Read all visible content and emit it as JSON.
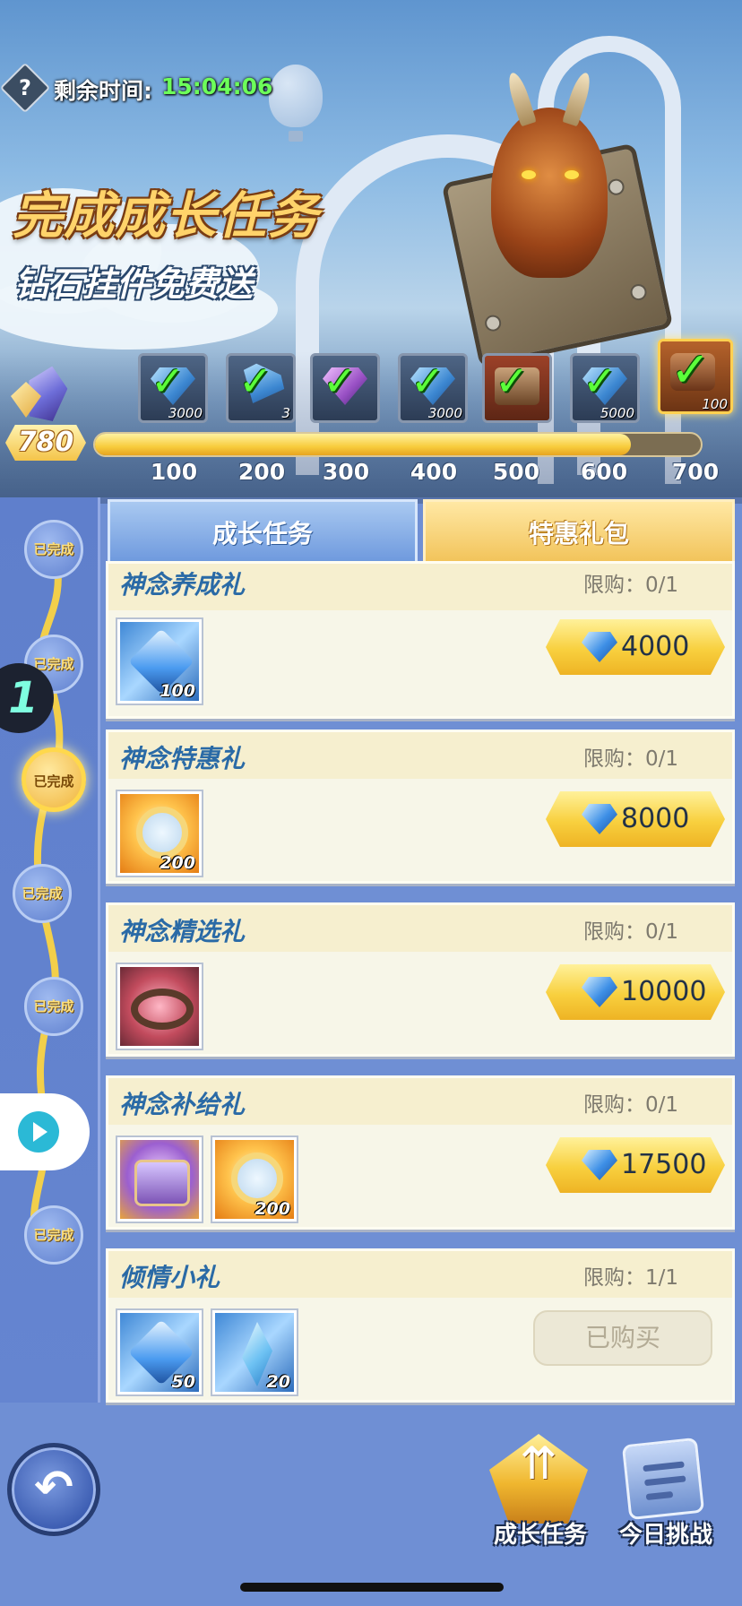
{
  "header": {
    "help_icon": "help-icon",
    "time_label": "剩余时间:",
    "time_value": "15:04:06",
    "title": "完成成长任务",
    "subtitle": "钻石挂件免费送"
  },
  "milestones": {
    "level": "780",
    "progress_fraction": 0.885,
    "rewards": [
      {
        "tick": "100",
        "qty": "3000",
        "claimed": true
      },
      {
        "tick": "200",
        "qty": "3",
        "claimed": true
      },
      {
        "tick": "300",
        "qty": "",
        "claimed": true
      },
      {
        "tick": "400",
        "qty": "3000",
        "claimed": true
      },
      {
        "tick": "500",
        "qty": "",
        "claimed": true
      },
      {
        "tick": "600",
        "qty": "5000",
        "claimed": true
      },
      {
        "tick": "700",
        "qty": "100",
        "claimed": true
      }
    ]
  },
  "sidebar": {
    "nodes": [
      {
        "label": "已完成"
      },
      {
        "label": "已完成"
      },
      {
        "label": "已完成"
      },
      {
        "label": "已完成"
      },
      {
        "label": "已完成"
      },
      {
        "label": "已完成"
      }
    ],
    "floating_badge": "1"
  },
  "tabs": [
    {
      "label": "成长任务"
    },
    {
      "label": "特惠礼包"
    }
  ],
  "packs": [
    {
      "title": "神念养成礼",
      "limit": "限购：0/1",
      "price": "4000",
      "items": [
        {
          "art": "gem",
          "qty": "100"
        }
      ]
    },
    {
      "title": "神念特惠礼",
      "limit": "限购：0/1",
      "price": "8000",
      "items": [
        {
          "art": "ring",
          "qty": "200"
        }
      ]
    },
    {
      "title": "神念精选礼",
      "limit": "限购：0/1",
      "price": "10000",
      "items": [
        {
          "art": "crown",
          "qty": ""
        }
      ]
    },
    {
      "title": "神念补给礼",
      "limit": "限购：0/1",
      "price": "17500",
      "items": [
        {
          "art": "chest",
          "qty": ""
        },
        {
          "art": "ring",
          "qty": "200"
        }
      ]
    },
    {
      "title": "倾情小礼",
      "limit": "限购：1/1",
      "bought_label": "已购买",
      "items": [
        {
          "art": "gem",
          "qty": "50"
        },
        {
          "art": "shard",
          "qty": "20"
        }
      ]
    }
  ],
  "bottom_nav": {
    "back_icon": "back-arrow-icon",
    "growth_label": "成长任务",
    "daily_label": "今日挑战"
  },
  "colors": {
    "timer": "#6dff5a",
    "title": "#ffd36a",
    "card_title": "#2a6aa6",
    "price_button": "#f8d03e"
  }
}
